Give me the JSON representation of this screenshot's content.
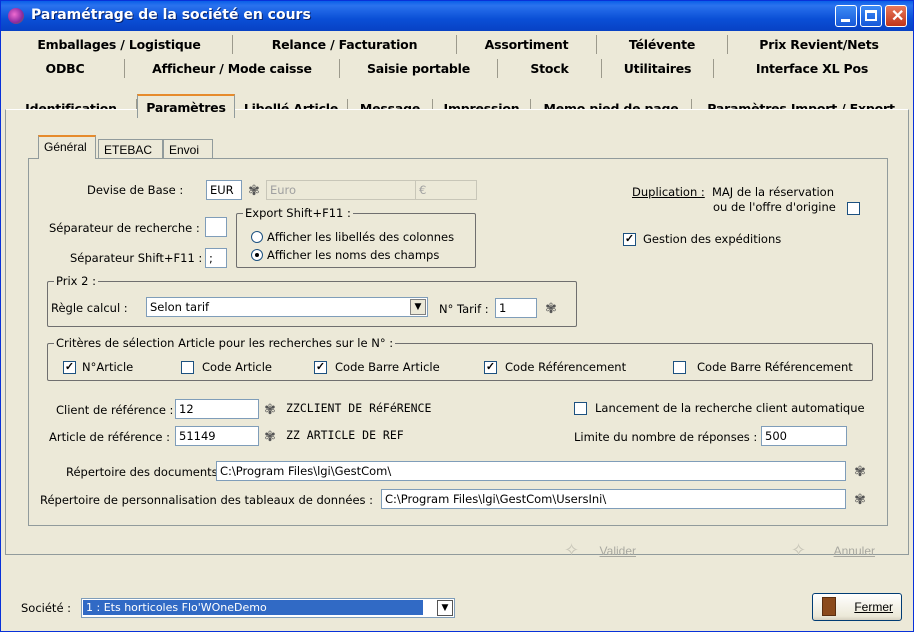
{
  "window": {
    "title": "Paramétrage de la société en cours"
  },
  "tabs": {
    "row1": [
      "Emballages / Logistique",
      "Relance / Facturation",
      "Assortiment",
      "Télévente",
      "Prix Revient/Nets"
    ],
    "row2": [
      "ODBC",
      "Afficheur / Mode caisse",
      "Saisie portable",
      "Stock",
      "Utilitaires",
      "Interface XL Pos"
    ],
    "row3": [
      "Identification",
      "Paramètres",
      "Libellé Article",
      "Message",
      "Impression",
      "Memo pied de page",
      "Paramètres Import / Export"
    ]
  },
  "subtabs": [
    "Général",
    "ETEBAC",
    "Envoi"
  ],
  "general": {
    "devise_label": "Devise de Base :",
    "devise_code": "EUR",
    "devise_name": "Euro",
    "devise_symbol": "€",
    "sep_recherche_label": "Séparateur de recherche :",
    "sep_recherche_value": "",
    "sep_shift_label": "Séparateur Shift+F11 :",
    "sep_shift_value": ";",
    "export_group": "Export Shift+F11 :",
    "export_opt1": "Afficher les libellés des colonnes",
    "export_opt2": "Afficher les noms des champs",
    "duplication_label": "Duplication :",
    "maj_line1": "MAJ de la réservation",
    "maj_line2": "ou de l'offre d'origine",
    "gestion_exped": "Gestion des expéditions",
    "prix2_group": "Prix 2 :",
    "regle_label": "Règle calcul :",
    "regle_value": "Selon tarif",
    "tarif_label": "N° Tarif :",
    "tarif_value": "1",
    "criteres_group": "Critères de sélection Article pour les recherches sur le N° :",
    "crit_narticle": "N°Article",
    "crit_code": "Code Article",
    "crit_barre": "Code Barre Article",
    "crit_ref": "Code Référencement",
    "crit_barre_ref": "Code Barre Référencement",
    "client_label": "Client de référence :",
    "client_code": "12",
    "client_name": "ZZCLIENT DE RéFéRENCE",
    "article_label": "Article de référence :",
    "article_code": "51149",
    "article_name": "ZZ ARTICLE DE REF",
    "lancement_label": "Lancement de la recherche client automatique",
    "limite_label": "Limite du nombre de réponses :",
    "limite_value": "500",
    "repdoc_label": "Répertoire des documents :",
    "repdoc_value": "C:\\Program Files\\lgi\\GestCom\\",
    "repperso_label": "Répertoire de personnalisation des tableaux de données :",
    "repperso_value": "C:\\Program Files\\lgi\\GestCom\\UsersIni\\"
  },
  "buttons": {
    "valider": "Valider",
    "annuler": "Annuler",
    "fermer": "Fermer"
  },
  "societe": {
    "label": "Société :",
    "value": "1 : Ets horticoles Flo'WOneDemo"
  }
}
